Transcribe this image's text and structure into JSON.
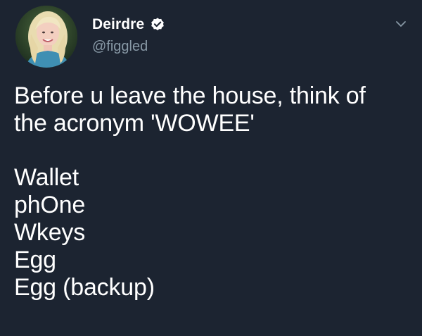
{
  "author": {
    "display_name": "Deirdre",
    "handle": "@figgled",
    "verified": true,
    "avatar_icon": "profile-photo"
  },
  "tweet": {
    "intro_line_1": "Before u leave the house, think of",
    "intro_line_2": "the acronym 'WOWEE'",
    "list": [
      "Wallet",
      "phOne",
      "Wkeys",
      "Egg",
      "Egg (backup)"
    ]
  },
  "colors": {
    "background": "#1c2431",
    "text": "#ffffff",
    "handle": "#8899a6",
    "verified_badge": "#ffffff"
  },
  "icons": {
    "verified": "verified-badge-icon",
    "menu": "chevron-down-icon"
  }
}
